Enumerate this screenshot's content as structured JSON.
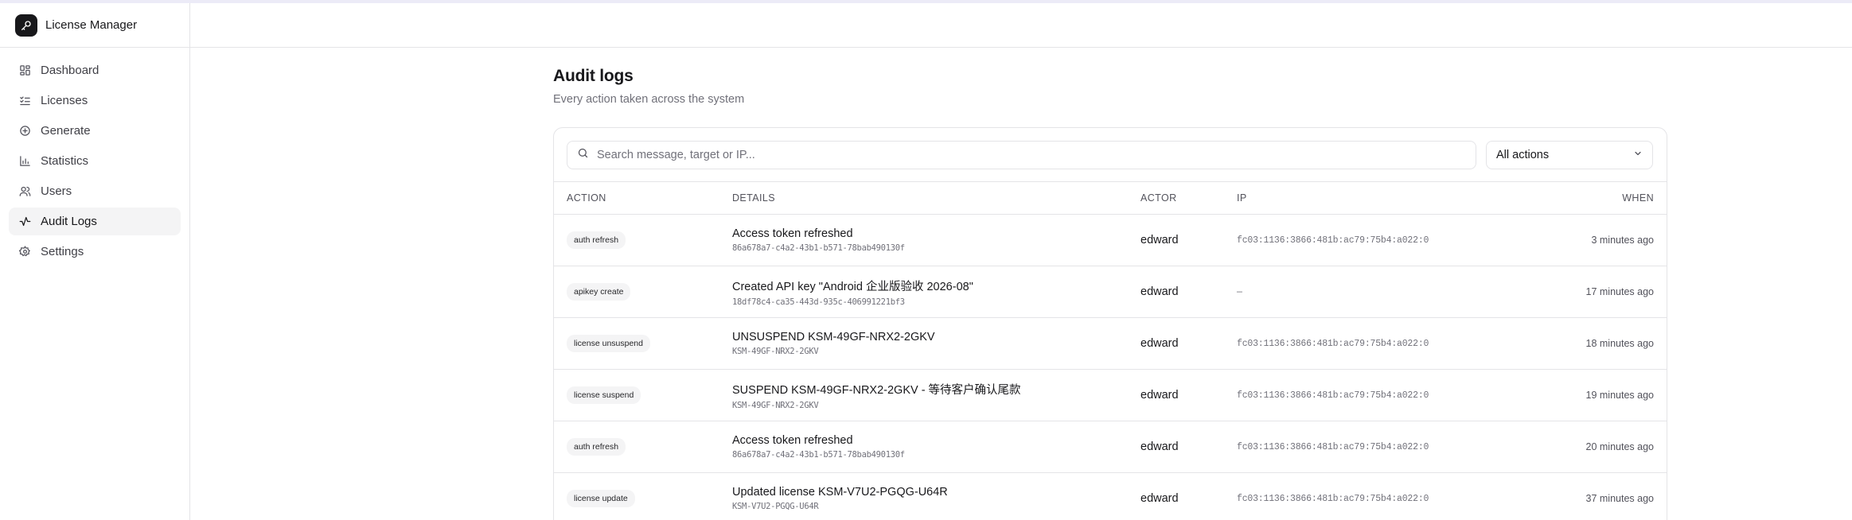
{
  "app": {
    "title": "License Manager"
  },
  "sidebar": {
    "items": [
      {
        "label": "Dashboard",
        "icon": "dashboard-icon"
      },
      {
        "label": "Licenses",
        "icon": "list-check-icon"
      },
      {
        "label": "Generate",
        "icon": "plus-circle-icon"
      },
      {
        "label": "Statistics",
        "icon": "bar-chart-icon"
      },
      {
        "label": "Users",
        "icon": "users-icon"
      },
      {
        "label": "Audit Logs",
        "icon": "activity-icon",
        "active": true
      },
      {
        "label": "Settings",
        "icon": "gear-icon"
      }
    ]
  },
  "page": {
    "title": "Audit logs",
    "subtitle": "Every action taken across the system"
  },
  "filters": {
    "search_placeholder": "Search message, target or IP...",
    "search_value": "",
    "action_select": "All actions"
  },
  "table": {
    "columns": {
      "action": "ACTION",
      "details": "DETAILS",
      "actor": "ACTOR",
      "ip": "IP",
      "when": "WHEN"
    },
    "rows": [
      {
        "action": "auth refresh",
        "title": "Access token refreshed",
        "sub": "86a678a7-c4a2-43b1-b571-78bab490130f",
        "actor": "edward",
        "ip": "fc03:1136:3866:481b:ac79:75b4:a022:0",
        "when": "3 minutes ago"
      },
      {
        "action": "apikey create",
        "title": "Created API key \"Android 企业版验收 2026-08\"",
        "sub": "18df78c4-ca35-443d-935c-406991221bf3",
        "actor": "edward",
        "ip": "—",
        "when": "17 minutes ago"
      },
      {
        "action": "license unsuspend",
        "title": "UNSUSPEND KSM-49GF-NRX2-2GKV",
        "sub": "KSM-49GF-NRX2-2GKV",
        "actor": "edward",
        "ip": "fc03:1136:3866:481b:ac79:75b4:a022:0",
        "when": "18 minutes ago"
      },
      {
        "action": "license suspend",
        "title": "SUSPEND KSM-49GF-NRX2-2GKV - 等待客户确认尾款",
        "sub": "KSM-49GF-NRX2-2GKV",
        "actor": "edward",
        "ip": "fc03:1136:3866:481b:ac79:75b4:a022:0",
        "when": "19 minutes ago"
      },
      {
        "action": "auth refresh",
        "title": "Access token refreshed",
        "sub": "86a678a7-c4a2-43b1-b571-78bab490130f",
        "actor": "edward",
        "ip": "fc03:1136:3866:481b:ac79:75b4:a022:0",
        "when": "20 minutes ago"
      },
      {
        "action": "license update",
        "title": "Updated license KSM-V7U2-PGQG-U64R",
        "sub": "KSM-V7U2-PGQG-U64R",
        "actor": "edward",
        "ip": "fc03:1136:3866:481b:ac79:75b4:a022:0",
        "when": "37 minutes ago"
      }
    ]
  }
}
